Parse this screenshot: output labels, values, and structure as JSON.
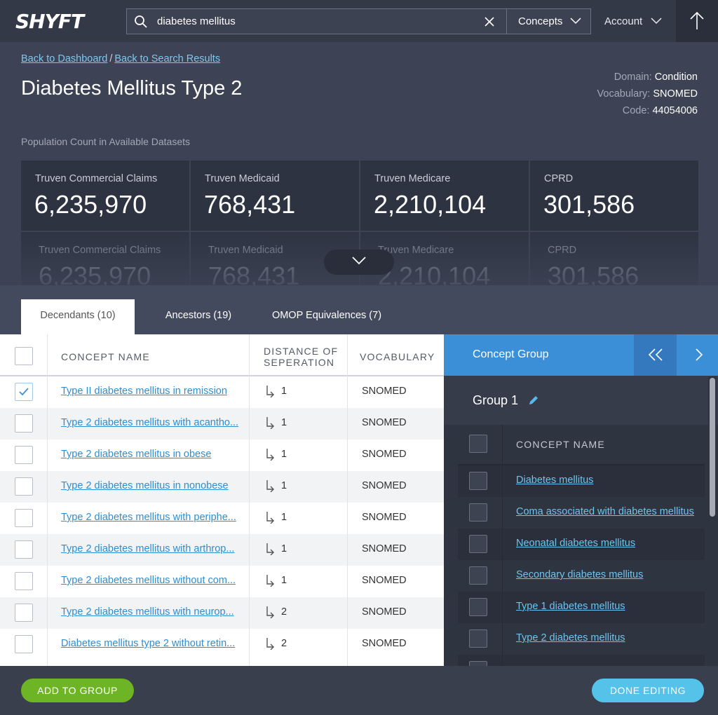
{
  "app": {
    "logo": "SHYFT"
  },
  "search": {
    "query": "diabetes mellitus",
    "type": "Concepts"
  },
  "account": {
    "label": "Account"
  },
  "breadcrumb": {
    "dashboard": "Back to Dashboard",
    "sep": "/",
    "results": "Back to Search Results"
  },
  "page": {
    "title": "Diabetes Mellitus Type 2"
  },
  "meta": {
    "domain_label": "Domain:",
    "domain": "Condition",
    "vocab_label": "Vocabulary:",
    "vocab": "SNOMED",
    "code_label": "Code:",
    "code": "44054006"
  },
  "population": {
    "label": "Population Count in Available Datasets",
    "cards": [
      {
        "name": "Truven Commercial Claims",
        "count": "6,235,970"
      },
      {
        "name": "Truven Medicaid",
        "count": "768,431"
      },
      {
        "name": "Truven Medicare",
        "count": "2,210,104"
      },
      {
        "name": "CPRD",
        "count": "301,586"
      }
    ]
  },
  "tabs": [
    {
      "label": "Decendants (10)"
    },
    {
      "label": "Ancestors (19)"
    },
    {
      "label": "OMOP Equivalences (7)"
    }
  ],
  "table": {
    "headers": {
      "name": "CONCEPT NAME",
      "distance_1": "DISTANCE OF",
      "distance_2": "SEPERATION",
      "vocab": "VOCABULARY"
    },
    "rows": [
      {
        "name": "Type II diabetes mellitus in remission",
        "distance": "1",
        "vocab": "SNOMED"
      },
      {
        "name": "Type 2 diabetes mellitus with acantho...",
        "distance": "1",
        "vocab": "SNOMED"
      },
      {
        "name": "Type 2 diabetes mellitus in obese",
        "distance": "1",
        "vocab": "SNOMED"
      },
      {
        "name": "Type 2 diabetes mellitus in nonobese",
        "distance": "1",
        "vocab": "SNOMED"
      },
      {
        "name": "Type 2 diabetes mellitus with periphe...",
        "distance": "1",
        "vocab": "SNOMED"
      },
      {
        "name": "Type 2 diabetes mellitus with arthrop...",
        "distance": "1",
        "vocab": "SNOMED"
      },
      {
        "name": "Type 2 diabetes mellitus without com...",
        "distance": "1",
        "vocab": "SNOMED"
      },
      {
        "name": "Type 2 diabetes mellitus with neurop...",
        "distance": "2",
        "vocab": "SNOMED"
      },
      {
        "name": "Diabetes mellitus type 2 without retin...",
        "distance": "2",
        "vocab": "SNOMED"
      }
    ]
  },
  "concept_group": {
    "title": "Concept Group",
    "group_name": "Group 1",
    "header": "CONCEPT NAME",
    "items": [
      {
        "name": "Diabetes mellitus"
      },
      {
        "name": "Coma associated with diabetes mellitus"
      },
      {
        "name": "Neonatal diabetes mellitus"
      },
      {
        "name": "Secondary diabetes mellitus"
      },
      {
        "name": "Type 1 diabetes mellitus"
      },
      {
        "name": "Type 2 diabetes mellitus"
      }
    ]
  },
  "footer": {
    "add": "ADD TO GROUP",
    "done": "DONE EDITING"
  },
  "colors": {
    "accent_blue": "#3b8fd6",
    "link": "#2f8dd1",
    "add_green": "#6eb526",
    "done_cyan": "#55c2ea"
  }
}
